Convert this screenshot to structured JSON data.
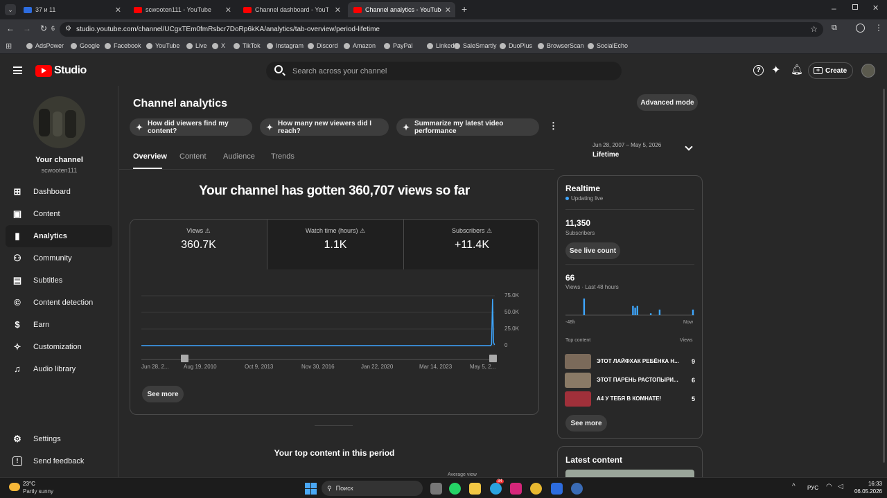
{
  "browser": {
    "tabs": [
      {
        "title": "37 и 11",
        "color": "#2d6cdf"
      },
      {
        "title": "scwooten111 - YouTube",
        "color": "#ff0000"
      },
      {
        "title": "Channel dashboard - YouTube",
        "color": "#ff0000"
      },
      {
        "title": "Channel analytics - YouTube St",
        "color": "#ff0000"
      }
    ],
    "url": "studio.youtube.com/channel/UCgxTEm0fmRsbcr7DoRp6kKA/analytics/tab-overview/period-lifetime",
    "tab_count": "6",
    "bookmarks": [
      "AdsPower",
      "Google",
      "Facebook",
      "YouTube",
      "Live",
      "X",
      "TikTok",
      "Instagram",
      "Discord",
      "Amazon",
      "PayPal",
      "Linkedin",
      "SaleSmartly",
      "DuoPlus",
      "BrowserScan",
      "SocialEcho"
    ]
  },
  "header": {
    "logo_text": "Studio",
    "search_placeholder": "Search across your channel",
    "create_label": "Create"
  },
  "sidebar": {
    "channel_title": "Your channel",
    "channel_handle": "scwooten111",
    "items": [
      {
        "label": "Dashboard",
        "icon": "dashboard-icon"
      },
      {
        "label": "Content",
        "icon": "content-icon"
      },
      {
        "label": "Analytics",
        "icon": "analytics-icon"
      },
      {
        "label": "Community",
        "icon": "community-icon"
      },
      {
        "label": "Subtitles",
        "icon": "subtitles-icon"
      },
      {
        "label": "Content detection",
        "icon": "copyright-icon"
      },
      {
        "label": "Earn",
        "icon": "dollar-icon"
      },
      {
        "label": "Customization",
        "icon": "magic-wand-icon"
      },
      {
        "label": "Audio library",
        "icon": "audio-library-icon"
      }
    ],
    "settings_label": "Settings",
    "feedback_label": "Send feedback"
  },
  "main": {
    "title": "Channel analytics",
    "advanced_mode_label": "Advanced mode",
    "suggestions": [
      "How did viewers find my content?",
      "How many new viewers did I reach?",
      "Summarize my latest video performance"
    ],
    "tabs": [
      "Overview",
      "Content",
      "Audience",
      "Trends"
    ],
    "period_range": "Jun 28, 2007 – May 5, 2026",
    "period_label": "Lifetime",
    "headline": "Your channel has gotten 360,707 views so far",
    "metrics": [
      {
        "label": "Views",
        "value": "360.7K"
      },
      {
        "label": "Watch time (hours)",
        "value": "1.1K"
      },
      {
        "label": "Subscribers",
        "value": "+11.4K"
      }
    ],
    "see_more_label": "See more",
    "top_content_title": "Your top content in this period",
    "average_view_label": "Average view"
  },
  "chart_data": {
    "type": "line",
    "x_ticks": [
      "Jun 28, 2...",
      "Aug 19, 2010",
      "Oct 9, 2013",
      "Nov 30, 2016",
      "Jan 22, 2020",
      "Mar 14, 2023",
      "May 5, 2..."
    ],
    "y_ticks": [
      "75.0K",
      "50.0K",
      "25.0K",
      "0"
    ],
    "ylim": [
      0,
      75000
    ],
    "series": [
      {
        "values": [
          0,
          0,
          0,
          0,
          0,
          0,
          0,
          0,
          0,
          0,
          0,
          0,
          0,
          0,
          0,
          0,
          0,
          0,
          2000,
          70000,
          5000,
          1000
        ]
      }
    ],
    "color": "#3ea6ff",
    "grid": true
  },
  "realtime": {
    "title": "Realtime",
    "status": "Updating live",
    "subscribers_value": "11,350",
    "subscribers_label": "Subscribers",
    "live_count_label": "See live count",
    "views_value": "66",
    "views_label": "Views · Last 48 hours",
    "axis_start": "-48h",
    "axis_end": "Now",
    "bars": [
      0,
      0,
      0,
      0,
      0,
      0,
      0,
      0,
      9,
      0,
      0,
      0,
      0,
      0,
      0,
      0,
      0,
      0,
      0,
      0,
      0,
      0,
      0,
      0,
      0,
      0,
      0,
      0,
      0,
      0,
      5,
      4,
      5,
      0,
      0,
      0,
      0,
      0,
      1,
      0,
      0,
      0,
      3,
      0,
      0,
      0,
      0,
      0,
      0,
      0,
      0,
      0,
      0,
      0,
      0,
      0,
      0,
      3
    ],
    "top_content_label": "Top content",
    "views_col_label": "Views",
    "top_content": [
      {
        "title": "ЭТОТ ЛАЙФХАК РЕБЁНКА Н...",
        "views": "9",
        "color": "#7b6a5a"
      },
      {
        "title": "ЭТОТ ПАРЕНЬ РАСТОПЫРИ...",
        "views": "6",
        "color": "#8a7a66"
      },
      {
        "title": "А4 У ТЕБЯ В КОМНАТЕ!",
        "views": "5",
        "color": "#a0303a"
      }
    ],
    "see_more_label": "See more",
    "latest_title": "Latest content"
  },
  "taskbar": {
    "weather_temp": "23°C",
    "weather_desc": "Partly sunny",
    "search_label": "Поиск",
    "lang": "РУС",
    "time": "16:33",
    "date": "06.05.2026",
    "telegram_badge": "34"
  }
}
